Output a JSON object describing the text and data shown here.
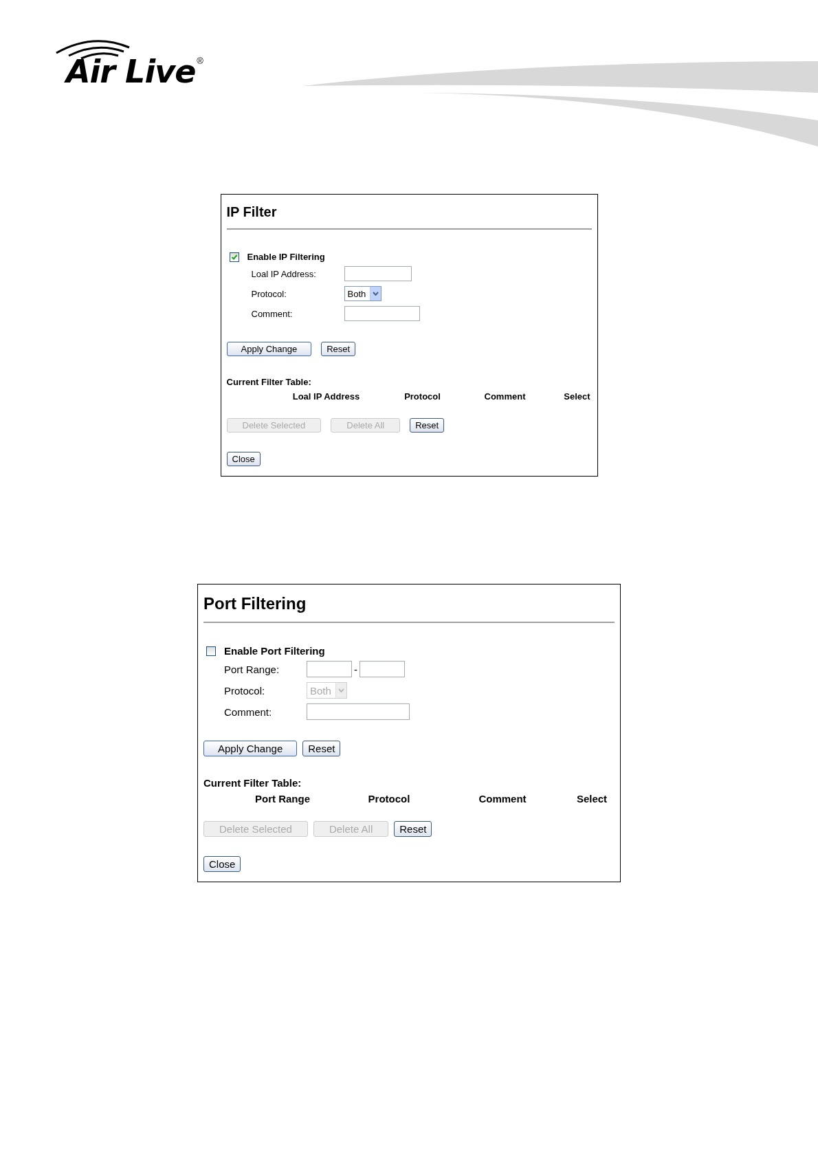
{
  "header": {
    "logo": "Air Live",
    "registered": "®"
  },
  "panels": [
    {
      "title": "IP Filter",
      "enable": {
        "label": "Enable IP Filtering",
        "checked": true
      },
      "fields": [
        {
          "kind": "text",
          "label": "Loal IP Address:"
        },
        {
          "kind": "select",
          "label": "Protocol:",
          "value": "Both",
          "disabled": false
        },
        {
          "kind": "text",
          "label": "Comment:"
        }
      ],
      "actions": [
        {
          "label": "Apply Change",
          "disabled": false
        },
        {
          "label": "Reset",
          "disabled": false
        }
      ],
      "table": {
        "title": "Current Filter Table:",
        "columns": [
          "Loal IP Address",
          "Protocol",
          "Comment",
          "Select"
        ]
      },
      "table_actions": [
        {
          "label": "Delete Selected",
          "disabled": true
        },
        {
          "label": "Delete All",
          "disabled": true
        },
        {
          "label": "Reset",
          "disabled": false
        }
      ],
      "close": "Close"
    },
    {
      "title": "Port Filtering",
      "enable": {
        "label": "Enable Port Filtering",
        "checked": false
      },
      "fields": [
        {
          "kind": "range",
          "label": "Port Range:",
          "separator": "-"
        },
        {
          "kind": "select",
          "label": "Protocol:",
          "value": "Both",
          "disabled": true
        },
        {
          "kind": "text",
          "label": "Comment:"
        }
      ],
      "actions": [
        {
          "label": "Apply Change",
          "disabled": false
        },
        {
          "label": "Reset",
          "disabled": false
        }
      ],
      "table": {
        "title": "Current Filter Table:",
        "columns": [
          "Port Range",
          "Protocol",
          "Comment",
          "Select"
        ]
      },
      "table_actions": [
        {
          "label": "Delete Selected",
          "disabled": true
        },
        {
          "label": "Delete All",
          "disabled": true
        },
        {
          "label": "Reset",
          "disabled": false
        }
      ],
      "close": "Close"
    }
  ]
}
